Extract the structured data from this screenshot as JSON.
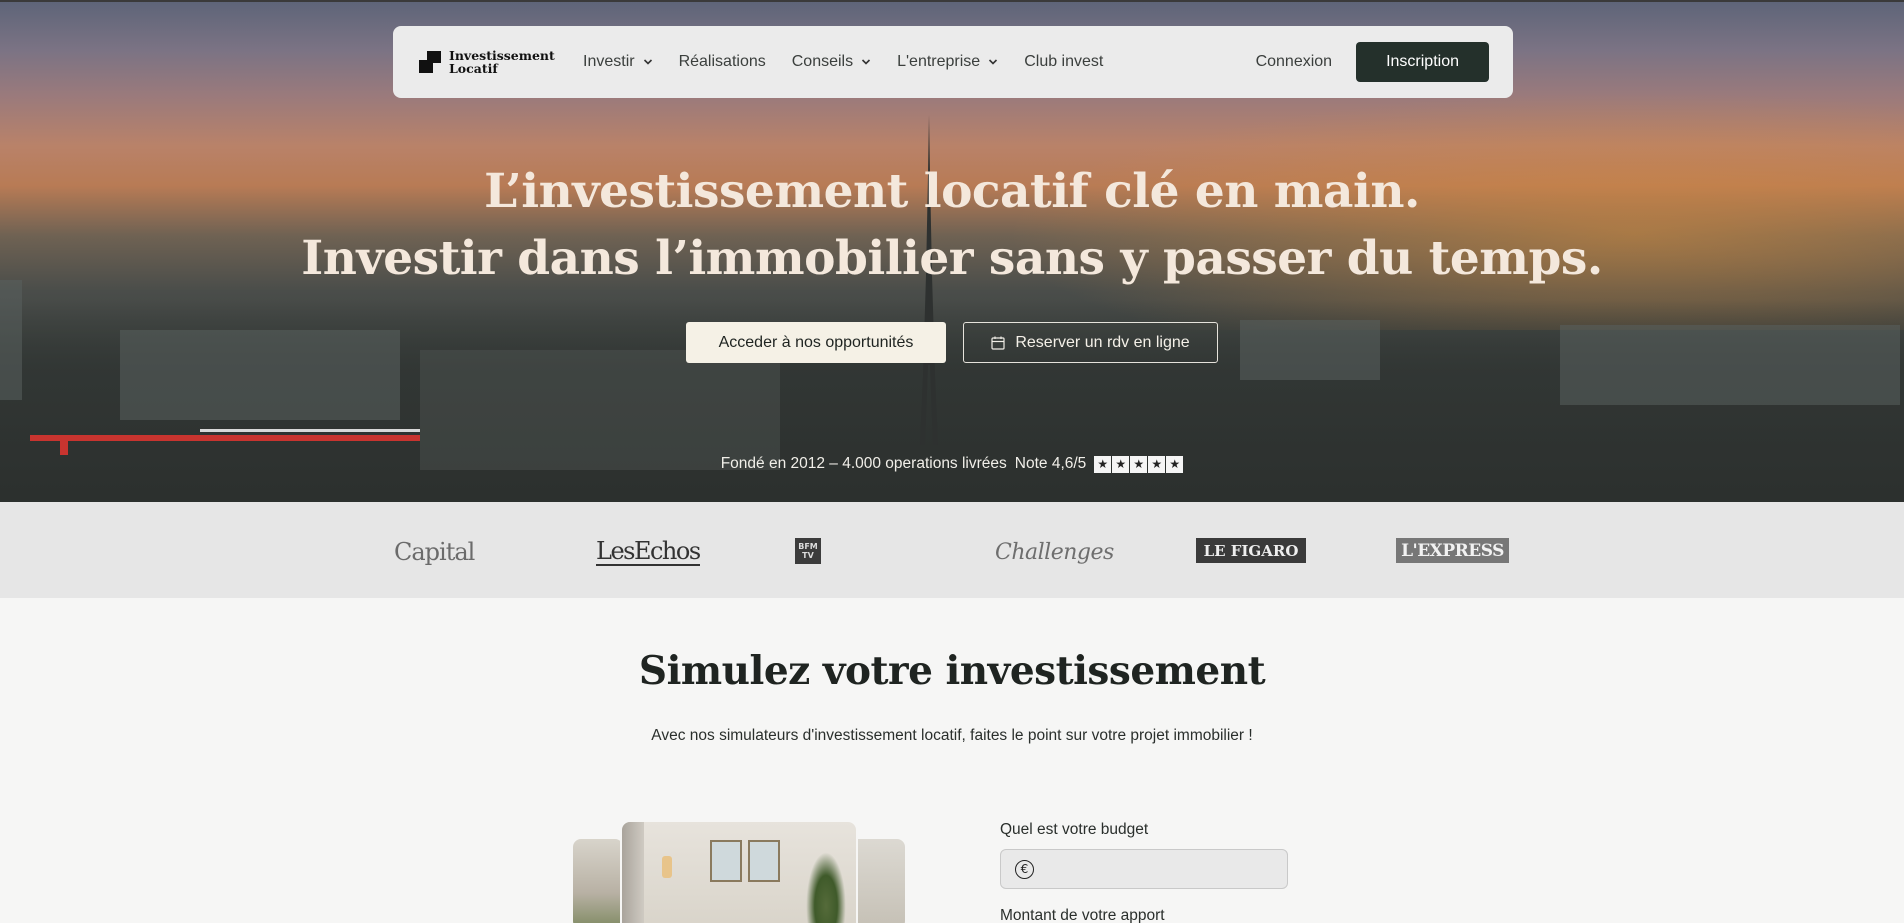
{
  "nav": {
    "logo_line1": "Investissement",
    "logo_line2": "Locatif",
    "items": [
      {
        "label": "Investir",
        "has_dropdown": true
      },
      {
        "label": "Réalisations",
        "has_dropdown": false
      },
      {
        "label": "Conseils",
        "has_dropdown": true
      },
      {
        "label": "L'entreprise",
        "has_dropdown": true
      },
      {
        "label": "Club invest",
        "has_dropdown": false
      }
    ],
    "login_label": "Connexion",
    "signup_label": "Inscription"
  },
  "hero": {
    "title_line1": "L’investissement locatif clé en main.",
    "title_line2": "Investir dans l’immobilier sans y passer du temps.",
    "cta_primary": "Acceder à nos opportunités",
    "cta_secondary": "Reserver un rdv en ligne",
    "cta_secondary_icon": "calendar-icon",
    "stats_text": "Fondé en 2012 – 4.000 operations livrées",
    "rating_text": "Note 4,6/5",
    "rating_stars": 5
  },
  "press": {
    "logos": [
      "Capital",
      "LesEchos",
      "BFM TV",
      "Challenges",
      "LE FIGARO",
      "L'EXPRESS"
    ],
    "bfm_line1": "BFM",
    "bfm_line2": "TV"
  },
  "simulator": {
    "title": "Simulez votre investissement",
    "subtitle": "Avec nos simulateurs d'investissement locatif, faites le point sur votre projet immobilier !",
    "budget_label": "Quel est votre budget",
    "budget_value": "",
    "budget_icon": "euro-icon",
    "apport_label": "Montant de votre apport"
  },
  "colors": {
    "nav_bg": "#ebebeb",
    "signup_bg": "#24302b",
    "hero_title": "#f4e8dc",
    "press_bg": "#e6e6e6",
    "page_bg": "#f6f6f5"
  }
}
